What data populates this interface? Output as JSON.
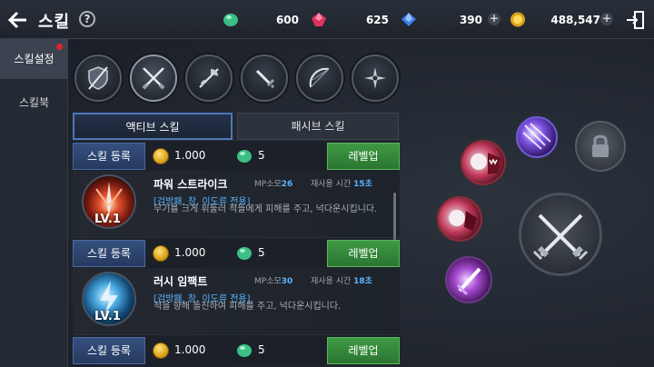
{
  "header": {
    "title": "스킬",
    "help_label": "?",
    "resources": [
      {
        "icon": "green-gem-icon",
        "value": "600"
      },
      {
        "icon": "red-gem-icon",
        "value": "625"
      },
      {
        "icon": "blue-gem-icon",
        "value": "390"
      },
      {
        "icon": "gold-coin-icon",
        "value": "488,547"
      }
    ],
    "plus_label": "+"
  },
  "sidebar": {
    "items": [
      {
        "label": "스킬설정",
        "active": true,
        "notification": true
      },
      {
        "label": "스킬북",
        "active": false,
        "notification": false
      }
    ]
  },
  "weapon_filters": [
    {
      "icon": "shield-sword-icon"
    },
    {
      "icon": "crossed-swords-icon"
    },
    {
      "icon": "axe-icon"
    },
    {
      "icon": "dagger-icon"
    },
    {
      "icon": "bow-icon"
    },
    {
      "icon": "shuriken-icon"
    }
  ],
  "tabs": {
    "active": "액티브 스킬",
    "passive": "패시브 스킬"
  },
  "rows": [
    {
      "register": "스킬 등록",
      "gold": "1.000",
      "gem": "5",
      "levelup": "레벨업"
    },
    {
      "register": "스킬 등록",
      "gold": "1.000",
      "gem": "5",
      "levelup": "레벨업"
    },
    {
      "register": "스킬 등록",
      "gold": "1.000",
      "gem": "5",
      "levelup": "레벨업"
    }
  ],
  "skills": [
    {
      "name": "파워 스트라이크",
      "level": "LV.1",
      "mp_label": "MP소모",
      "mp": "26",
      "cd_label": "재사용 시간",
      "cd": "15초",
      "weapons": "[검방패, 창, 이도류 전용]",
      "desc": "무기를 크게 휘둘러 적들에게 피해를 주고, 넉다운시킵니다."
    },
    {
      "name": "러시 임팩트",
      "level": "LV.1",
      "mp_label": "MP소모",
      "mp": "30",
      "cd_label": "재사용 시간",
      "cd": "18초",
      "weapons": "[검방패, 창, 이도류 전용]",
      "desc": "적을 향해 돌진하여 피해를 주고, 넉다운시킵니다."
    }
  ],
  "colors": {
    "accent_blue": "#4c78b8",
    "levelup_green": "#3f9a44",
    "notification_red": "#e0242c"
  }
}
